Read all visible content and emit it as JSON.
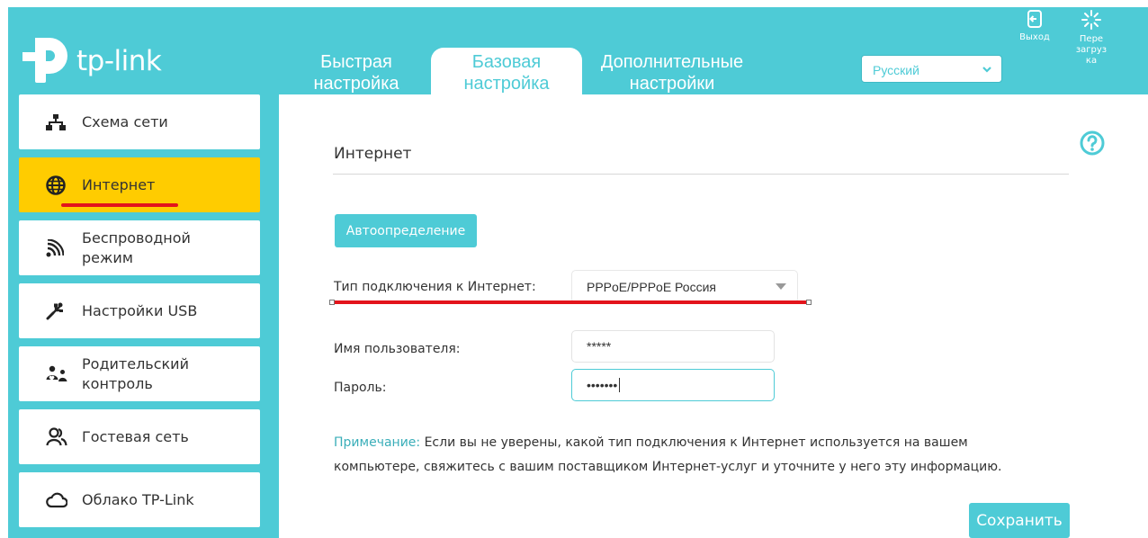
{
  "brand": {
    "logo_text": "tp-link"
  },
  "colors": {
    "accent": "#4ecbd6",
    "active": "#ffcc00",
    "highlight": "#e3141c"
  },
  "tabs": [
    {
      "line1": "Быстрая",
      "line2": "настройка"
    },
    {
      "line1": "Базовая",
      "line2": "настройка"
    },
    {
      "line1": "Дополнительные",
      "line2": "настройки"
    }
  ],
  "language": {
    "selected": "Русский"
  },
  "actions": {
    "exit_label": "Выход",
    "reboot_label_1": "Пере",
    "reboot_label_2": "загруз",
    "reboot_label_3": "ка"
  },
  "sidebar": {
    "items": [
      {
        "label": "Схема сети",
        "icon": "network-map-icon"
      },
      {
        "label": "Интернет",
        "icon": "globe-icon"
      },
      {
        "label_1": "Беспроводной",
        "label_2": "режим",
        "icon": "wireless-icon"
      },
      {
        "label": "Настройки USB",
        "icon": "usb-icon"
      },
      {
        "label_1": "Родительский",
        "label_2": "контроль",
        "icon": "parental-icon"
      },
      {
        "label": "Гостевая сеть",
        "icon": "guest-icon"
      },
      {
        "label": "Облако TP-Link",
        "icon": "cloud-icon"
      }
    ]
  },
  "main": {
    "title": "Интернет",
    "auto_detect_label": "Автоопределение",
    "connection_type_label": "Тип подключения к Интернет:",
    "connection_type_value": "PPPoE/PPPoE Россия",
    "username_label": "Имя пользователя:",
    "username_value": "*****",
    "password_label": "Пароль:",
    "password_value": "•••••••",
    "note_heading": "Примечание:",
    "note_text_1": "Если вы не уверены, какой тип подключения к Интернет используется на вашем",
    "note_text_2": "компьютере, свяжитесь с вашим поставщиком Интернет-услуг и уточните у него эту информацию.",
    "save_label": "Сохранить"
  }
}
